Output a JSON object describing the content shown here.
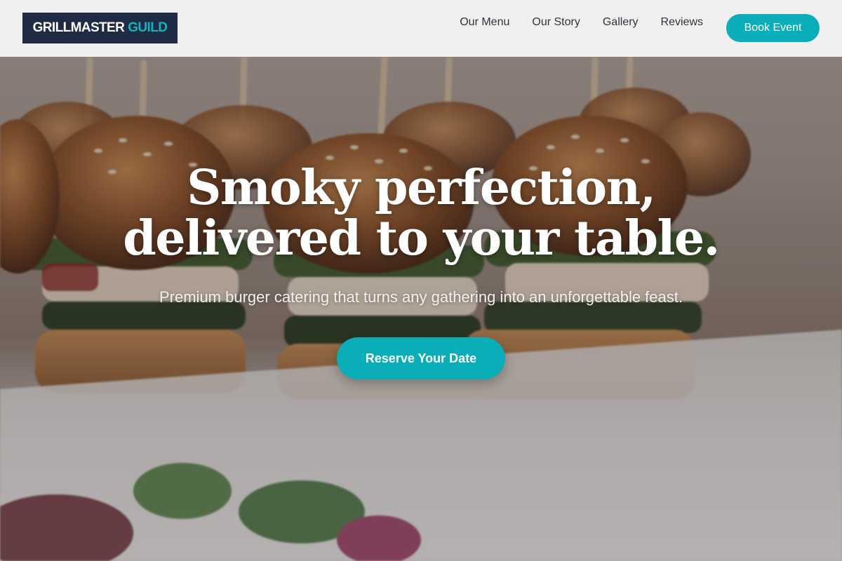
{
  "brand": {
    "name_primary": "GRILLMASTER",
    "name_accent": "GUILD",
    "colors": {
      "navy": "#1f2a44",
      "teal": "#0aaeb9"
    }
  },
  "nav": {
    "items": [
      {
        "label": "Our Menu"
      },
      {
        "label": "Our Story"
      },
      {
        "label": "Gallery"
      },
      {
        "label": "Reviews"
      }
    ],
    "cta_label": "Book Event"
  },
  "hero": {
    "headline_line1": "Smoky perfection,",
    "headline_line2": "delivered to your table.",
    "subheadline": "Premium burger catering that turns any gathering into an unforgettable feast.",
    "cta_label": "Reserve Your Date",
    "background_image": "slider-burgers-photo"
  }
}
